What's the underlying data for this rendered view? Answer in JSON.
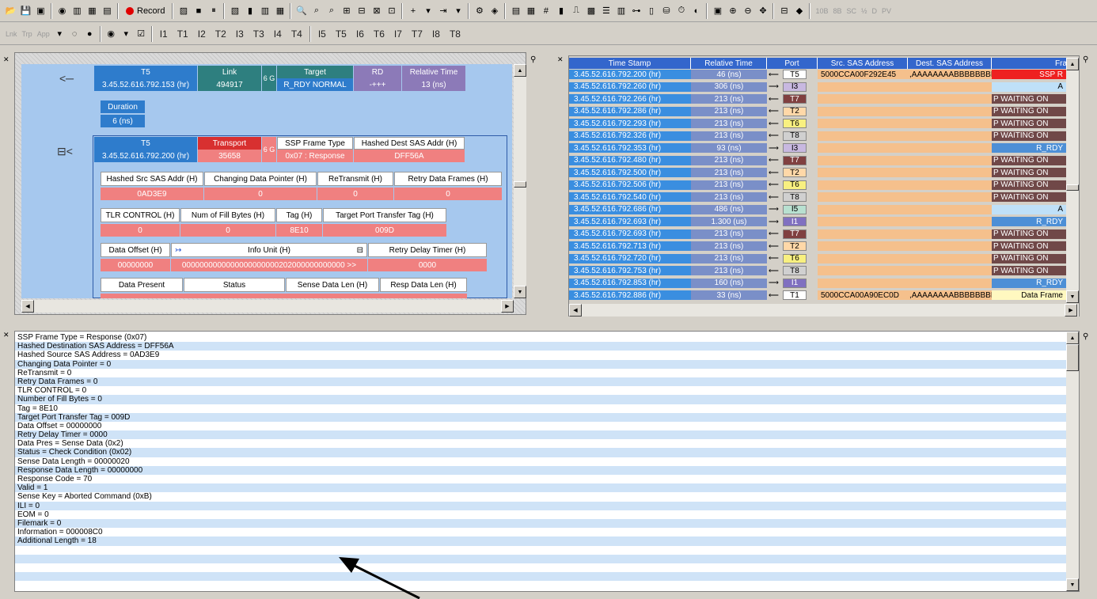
{
  "toolbar1": {
    "record_label": "Record",
    "right_labels": [
      "10B",
      "8B",
      "SC",
      "½",
      "D",
      "PV"
    ]
  },
  "toolbar2": {
    "filters": [
      "Lnk",
      "Trp",
      "App"
    ],
    "triggers": [
      "I1",
      "T1",
      "I2",
      "T2",
      "I3",
      "T3",
      "I4",
      "T4",
      "I5",
      "T5",
      "I6",
      "T6",
      "I7",
      "T7",
      "I8",
      "T8"
    ]
  },
  "left_pane": {
    "row1": {
      "port": "T5",
      "ts": "3.45.52.616.792.153 (hr)",
      "link_label": "Link",
      "link_val": "494917",
      "speed": "6 G",
      "target_label": "Target",
      "target_val": "R_RDY NORMAL",
      "rd_label": "RD",
      "rd_val": "-+++",
      "rel_label": "Relative Time",
      "rel_val": "13 (ns)"
    },
    "duration": {
      "label": "Duration",
      "value": "6 (ns)"
    },
    "row2": {
      "port": "T5",
      "ts": "3.45.52.616.792.200 (hr)",
      "transport_label": "Transport",
      "transport_val": "35658",
      "speed": "6 G",
      "frame_type_label": "SSP Frame Type",
      "frame_type_val": "0x07 : Response",
      "hdest_label": "Hashed Dest SAS Addr (H)",
      "hdest_val": "DFF56A"
    },
    "fields1": [
      {
        "label": "Hashed Src SAS Addr (H)",
        "value": "0AD3E9"
      },
      {
        "label": "Changing Data Pointer (H)",
        "value": "0"
      },
      {
        "label": "ReTransmit (H)",
        "value": "0"
      },
      {
        "label": "Retry Data Frames (H)",
        "value": "0"
      }
    ],
    "fields2": [
      {
        "label": "TLR CONTROL (H)",
        "value": "0"
      },
      {
        "label": "Num of Fill Bytes (H)",
        "value": "0"
      },
      {
        "label": "Tag (H)",
        "value": "8E10"
      },
      {
        "label": "Target Port Transfer Tag (H)",
        "value": "009D"
      }
    ],
    "fields3": [
      {
        "label": "Data Offset (H)",
        "value": "00000000"
      },
      {
        "label": "Info Unit (H)",
        "value": "0000000000000000000000202000000000000 >>"
      },
      {
        "label": "Retry Delay Timer (H)",
        "value": "0000"
      }
    ],
    "fields4": [
      "Data Present",
      "Status",
      "Sense Data Len (H)",
      "Resp Data Len (H)"
    ]
  },
  "right_pane": {
    "columns": [
      "Time Stamp",
      "Relative Time",
      "Port",
      "Src. SAS Address",
      "Dest. SAS Address",
      "Fra"
    ],
    "rows": [
      {
        "ts": "3.45.52.616.792.200 (hr)",
        "rel": "46 (ns)",
        "port": "T5",
        "src": "5000CCA00F292E45",
        "dst": ",AAAAAAAABBBBBBBB",
        "frame": "SSP R",
        "dir": "in",
        "pcolor": "#ffffff",
        "fcolor": "#ee2020"
      },
      {
        "ts": "3.45.52.616.792.260 (hr)",
        "rel": "306 (ns)",
        "port": "I3",
        "src": "",
        "dst": "",
        "frame": "A",
        "dir": "out",
        "pcolor": "#c8b8e0",
        "fcolor": "#bfe0f8"
      },
      {
        "ts": "3.45.52.616.792.266 (hr)",
        "rel": "213 (ns)",
        "port": "T7",
        "src": "",
        "dst": "",
        "frame": "P WAITING ON",
        "dir": "in",
        "pcolor": "#804040",
        "fcolor": "#704848"
      },
      {
        "ts": "3.45.52.616.792.286 (hr)",
        "rel": "213 (ns)",
        "port": "T2",
        "src": "",
        "dst": "",
        "frame": "P WAITING ON",
        "dir": "in",
        "pcolor": "#ffd8a8",
        "fcolor": "#704848"
      },
      {
        "ts": "3.45.52.616.792.293 (hr)",
        "rel": "213 (ns)",
        "port": "T6",
        "src": "",
        "dst": "",
        "frame": "P WAITING ON",
        "dir": "in",
        "pcolor": "#f8f080",
        "fcolor": "#704848"
      },
      {
        "ts": "3.45.52.616.792.326 (hr)",
        "rel": "213 (ns)",
        "port": "T8",
        "src": "",
        "dst": "",
        "frame": "P WAITING ON",
        "dir": "in",
        "pcolor": "#d0d0d0",
        "fcolor": "#704848"
      },
      {
        "ts": "3.45.52.616.792.353 (hr)",
        "rel": "93 (ns)",
        "port": "I3",
        "src": "",
        "dst": "",
        "frame": "R_RDY",
        "dir": "out",
        "pcolor": "#c8b8e0",
        "fcolor": "#4d8fd6"
      },
      {
        "ts": "3.45.52.616.792.480 (hr)",
        "rel": "213 (ns)",
        "port": "T7",
        "src": "",
        "dst": "",
        "frame": "P WAITING ON",
        "dir": "in",
        "pcolor": "#804040",
        "fcolor": "#704848"
      },
      {
        "ts": "3.45.52.616.792.500 (hr)",
        "rel": "213 (ns)",
        "port": "T2",
        "src": "",
        "dst": "",
        "frame": "P WAITING ON",
        "dir": "in",
        "pcolor": "#ffd8a8",
        "fcolor": "#704848"
      },
      {
        "ts": "3.45.52.616.792.506 (hr)",
        "rel": "213 (ns)",
        "port": "T6",
        "src": "",
        "dst": "",
        "frame": "P WAITING ON",
        "dir": "in",
        "pcolor": "#f8f080",
        "fcolor": "#704848"
      },
      {
        "ts": "3.45.52.616.792.540 (hr)",
        "rel": "213 (ns)",
        "port": "T8",
        "src": "",
        "dst": "",
        "frame": "P WAITING ON",
        "dir": "in",
        "pcolor": "#d0d0d0",
        "fcolor": "#704848"
      },
      {
        "ts": "3.45.52.616.792.686 (hr)",
        "rel": "486 (ns)",
        "port": "I5",
        "src": "",
        "dst": "",
        "frame": "A",
        "dir": "out",
        "pcolor": "#b8e0d0",
        "fcolor": "#bfe0f8"
      },
      {
        "ts": "3.45.52.616.792.693 (hr)",
        "rel": "1.300 (us)",
        "port": "I1",
        "src": "",
        "dst": "",
        "frame": "R_RDY",
        "dir": "out",
        "pcolor": "#8070c0",
        "fcolor": "#4d8fd6"
      },
      {
        "ts": "3.45.52.616.792.693 (hr)",
        "rel": "213 (ns)",
        "port": "T7",
        "src": "",
        "dst": "",
        "frame": "P WAITING ON",
        "dir": "in",
        "pcolor": "#804040",
        "fcolor": "#704848"
      },
      {
        "ts": "3.45.52.616.792.713 (hr)",
        "rel": "213 (ns)",
        "port": "T2",
        "src": "",
        "dst": "",
        "frame": "P WAITING ON",
        "dir": "in",
        "pcolor": "#ffd8a8",
        "fcolor": "#704848"
      },
      {
        "ts": "3.45.52.616.792.720 (hr)",
        "rel": "213 (ns)",
        "port": "T6",
        "src": "",
        "dst": "",
        "frame": "P WAITING ON",
        "dir": "in",
        "pcolor": "#f8f080",
        "fcolor": "#704848"
      },
      {
        "ts": "3.45.52.616.792.753 (hr)",
        "rel": "213 (ns)",
        "port": "T8",
        "src": "",
        "dst": "",
        "frame": "P WAITING ON",
        "dir": "in",
        "pcolor": "#d0d0d0",
        "fcolor": "#704848"
      },
      {
        "ts": "3.45.52.616.792.853 (hr)",
        "rel": "160 (ns)",
        "port": "I1",
        "src": "",
        "dst": "",
        "frame": "R_RDY",
        "dir": "out",
        "pcolor": "#8070c0",
        "fcolor": "#4d8fd6"
      },
      {
        "ts": "3.45.52.616.792.886 (hr)",
        "rel": "33 (ns)",
        "port": "T1",
        "src": "5000CCA00A90EC0D",
        "dst": ",AAAAAAAABBBBBBBB",
        "frame": "Data Frame",
        "dir": "in",
        "pcolor": "#ffffff",
        "fcolor": "#fff8c0"
      }
    ]
  },
  "details": [
    "SSP Frame Type = Response (0x07)",
    "Hashed Destination SAS Address = DFF56A",
    "Hashed Source SAS Address = 0AD3E9",
    "Changing Data Pointer = 0",
    "ReTransmit = 0",
    "Retry Data Frames = 0",
    "TLR CONTROL = 0",
    "Number of Fill Bytes = 0",
    "Tag = 8E10",
    "Target Port Transfer Tag = 009D",
    "Data Offset = 00000000",
    "Retry Delay Timer = 0000",
    "Data Pres = Sense Data (0x2)",
    "Status = Check Condition (0x02)",
    "Sense Data Length = 00000020",
    "Response Data Length = 00000000",
    "Response Code = 70",
    "Valid = 1",
    "Sense Key = Aborted Command (0xB)",
    "ILI = 0",
    "EOM = 0",
    "Filemark = 0",
    "Information = 000008C0",
    "Additional Length = 18"
  ]
}
